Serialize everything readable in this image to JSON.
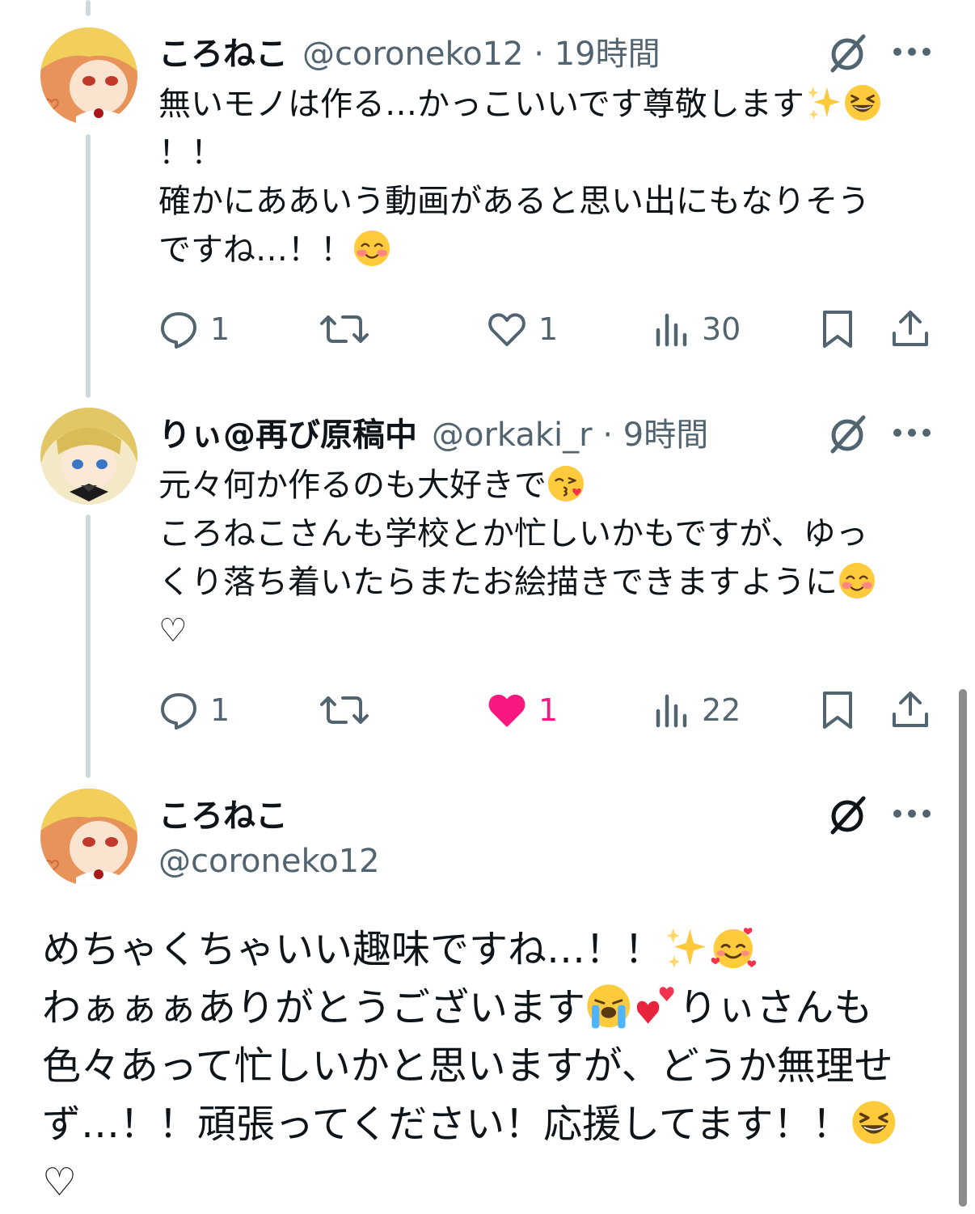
{
  "tweets": [
    {
      "display_name": "ころねこ",
      "handle_meta": "@coroneko12 · 19時間",
      "lines": [
        "無いモノは作る…かっこいいです尊敬します",
        "！！",
        "確かにああいう動画があると思い出にもなりそう",
        "ですね…！！"
      ],
      "actions": {
        "replies": "1",
        "retweets": "",
        "likes": "1",
        "views": "30"
      },
      "liked": false
    },
    {
      "display_name": "りぃ@再び原稿中",
      "handle_meta": "@orkaki_r · 9時間",
      "lines": [
        "元々何か作るのも大好きで",
        "ころねこさんも学校とか忙しいかもですが、ゆっ",
        "くり落ち着いたらまたお絵描きできますように",
        "♡"
      ],
      "actions": {
        "replies": "1",
        "retweets": "",
        "likes": "1",
        "views": "22"
      },
      "liked": true
    }
  ],
  "main_tweet": {
    "display_name": "ころねこ",
    "handle": "@coroneko12",
    "lines": [
      "めちゃくちゃいい趣味ですね…！！",
      "わぁぁぁありがとうございます",
      "りぃさんも",
      "色々あって忙しいかと思いますが、どうか無理せ",
      "ず…！！頑張ってください！応援してます！！",
      "♡"
    ]
  },
  "icons": {
    "reply": "reply-bubble-icon",
    "retweet": "retweet-icon",
    "like": "heart-icon",
    "views": "views-bar-icon",
    "bookmark": "bookmark-icon",
    "share": "share-icon",
    "grok": "grok-slash-icon",
    "more": "more-dots-icon"
  },
  "colors": {
    "text": "#0f1419",
    "secondary": "#536471",
    "like": "#f91880",
    "thread": "#cfd9de"
  }
}
